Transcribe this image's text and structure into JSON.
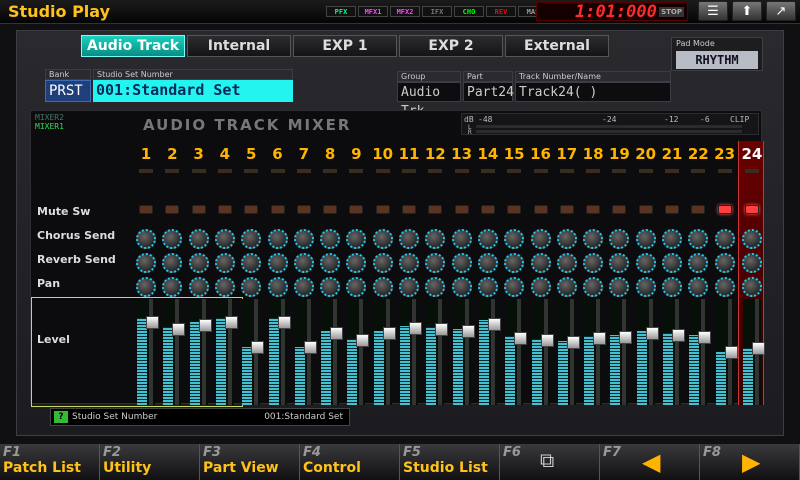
{
  "title": "Studio Play",
  "fx": [
    "PFX",
    "MFX1",
    "MFX2",
    "IFX",
    "CHO",
    "REV",
    "MAS"
  ],
  "fx_colors": [
    "#0f8",
    "#f4f",
    "#f4f",
    "#777",
    "#0f0",
    "#f00",
    "#999"
  ],
  "counter": "1:01:000",
  "counter_state": "STOP",
  "top_icons": [
    "menu-icon",
    "up-arrow-icon",
    "export-icon"
  ],
  "tabs": [
    "Audio Track",
    "Internal",
    "EXP 1",
    "EXP 2",
    "External"
  ],
  "active_tab": 0,
  "pad_mode": {
    "label": "Pad Mode",
    "value": "RHYTHM"
  },
  "bank": {
    "label": "Bank",
    "value": "PRST"
  },
  "studio_set": {
    "label": "Studio Set Number",
    "value": "001:Standard Set"
  },
  "group": {
    "label": "Group",
    "value": "Audio Trk"
  },
  "part": {
    "label": "Part",
    "value": "Part24"
  },
  "track": {
    "label": "Track Number/Name",
    "value": "Track24(          )"
  },
  "mixer": {
    "modes": [
      "MIXER2",
      "MIXER1"
    ],
    "title": "AUDIO TRACK MIXER",
    "scale": [
      "dB",
      "-48",
      "-24",
      "-12",
      "-6",
      "CLIP"
    ],
    "meter_rows": [
      "L",
      "R"
    ],
    "row_labels": {
      "mute": "Mute Sw",
      "chorus": "Chorus Send",
      "reverb": "Reverb Send",
      "pan": "Pan",
      "level": "Level"
    },
    "channels": [
      "1",
      "2",
      "3",
      "4",
      "5",
      "6",
      "7",
      "8",
      "9",
      "10",
      "11",
      "12",
      "13",
      "14",
      "15",
      "16",
      "17",
      "18",
      "19",
      "20",
      "21",
      "22",
      "23",
      "24"
    ],
    "selected": 24,
    "mute_on": [
      23,
      24
    ],
    "levels": [
      0.82,
      0.74,
      0.78,
      0.82,
      0.55,
      0.82,
      0.55,
      0.7,
      0.62,
      0.7,
      0.75,
      0.74,
      0.72,
      0.8,
      0.65,
      0.62,
      0.6,
      0.65,
      0.66,
      0.7,
      0.68,
      0.66,
      0.5,
      0.54
    ]
  },
  "hint": {
    "label": "Studio Set Number",
    "value": "001:Standard Set"
  },
  "fkeys": [
    {
      "num": "F1",
      "label": "Patch List"
    },
    {
      "num": "F2",
      "label": "Utility"
    },
    {
      "num": "F3",
      "label": "Part View"
    },
    {
      "num": "F4",
      "label": "Control"
    },
    {
      "num": "F5",
      "label": "Studio List"
    },
    {
      "num": "F6",
      "label": ""
    },
    {
      "num": "F7",
      "label": ""
    },
    {
      "num": "F8",
      "label": ""
    }
  ]
}
